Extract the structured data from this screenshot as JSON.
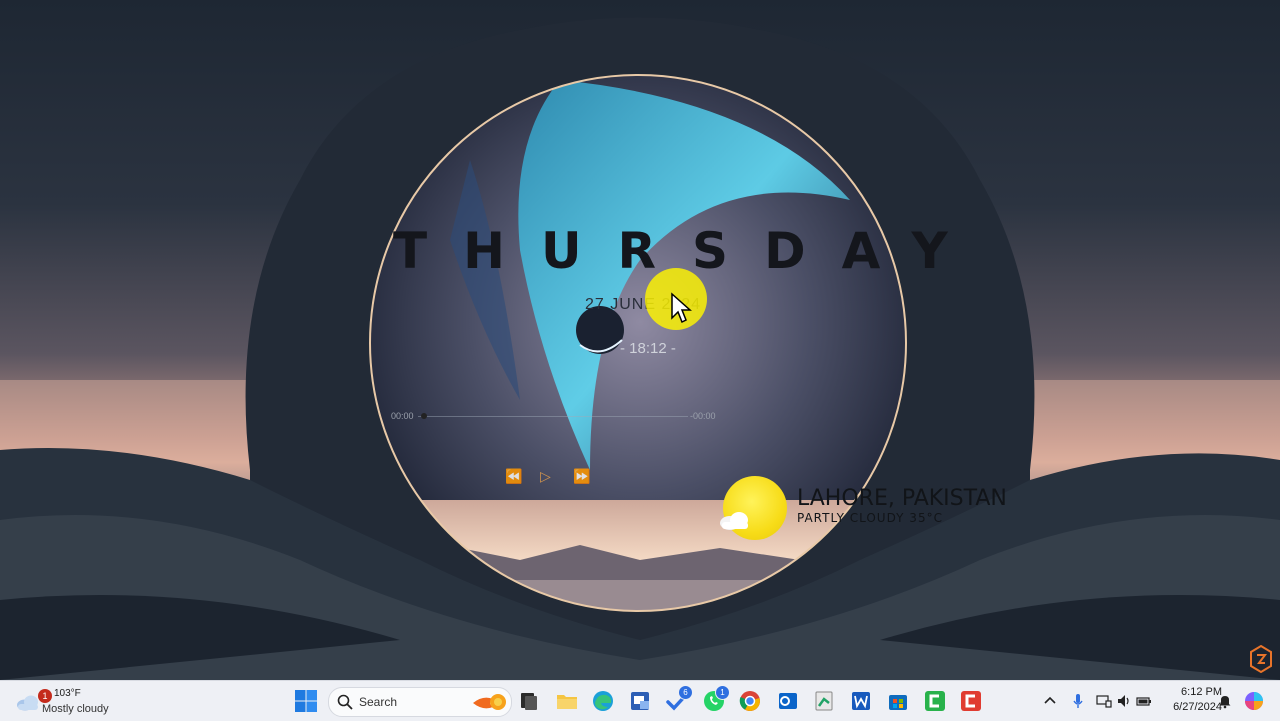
{
  "desktop": {
    "day": "THURSDAY",
    "date": "27 JUNE 2024",
    "time": "- 18:12 -",
    "media": {
      "elapsed": "00:00",
      "remaining": "-00:00",
      "prev": "⏪",
      "play": "▷",
      "next": "⏩"
    },
    "weather": {
      "city": "LAHORE, PAKISTAN",
      "condition": "PARTLY CLOUDY 35°C"
    }
  },
  "taskbar": {
    "weather": {
      "temp": "103°F",
      "condition": "Mostly cloudy",
      "badge": "1"
    },
    "search_label": "Search",
    "apps": [
      {
        "name": "task-view",
        "badge": ""
      },
      {
        "name": "file-explorer",
        "badge": ""
      },
      {
        "name": "edge",
        "badge": ""
      },
      {
        "name": "outlook-classic",
        "badge": ""
      },
      {
        "name": "todo",
        "badge": "6"
      },
      {
        "name": "whatsapp",
        "badge": "1"
      },
      {
        "name": "chrome",
        "badge": ""
      },
      {
        "name": "outlook",
        "badge": ""
      },
      {
        "name": "excel-pad",
        "badge": ""
      },
      {
        "name": "word",
        "badge": ""
      },
      {
        "name": "store",
        "badge": ""
      },
      {
        "name": "camtasia-green",
        "badge": ""
      },
      {
        "name": "camtasia-red",
        "badge": ""
      }
    ],
    "clock": {
      "time": "6:12 PM",
      "date": "6/27/2024"
    }
  },
  "colors": {
    "taskbar_bg": "#eef0f5",
    "accent_blue": "#2f6fe0",
    "sun_yellow": "#f7dc18"
  }
}
